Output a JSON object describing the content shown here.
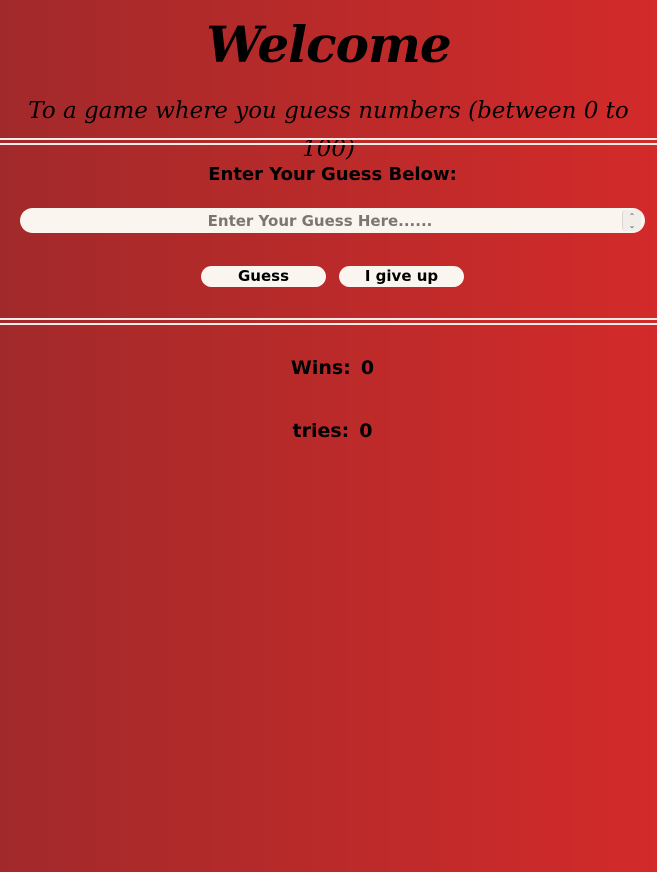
{
  "header": {
    "title": "Welcome",
    "subtitle": "To a game where you guess numbers (between 0 to 100)"
  },
  "form": {
    "label": "Enter Your Guess Below:",
    "input_placeholder": "Enter Your Guess Here......",
    "input_value": "",
    "guess_button": "Guess",
    "giveup_button": "I give up"
  },
  "stats": {
    "wins_label": "Wins:",
    "wins_value": "0",
    "tries_label": "tries:",
    "tries_value": "0"
  },
  "colors": {
    "background_left": "#a2292b",
    "background_right": "#d32a2a",
    "field_background": "#faf5ef",
    "rule": "#f7ece8"
  },
  "icons": {
    "spinner_up": "chevron-up-icon",
    "spinner_down": "chevron-down-icon"
  }
}
